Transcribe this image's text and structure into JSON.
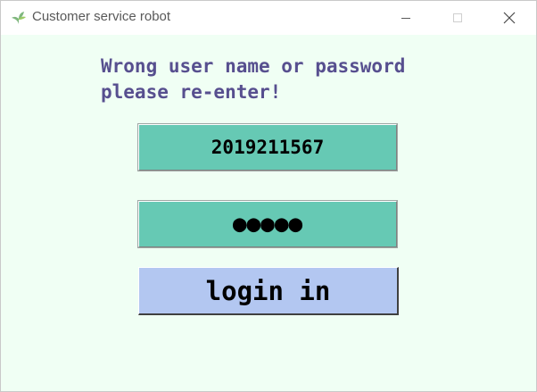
{
  "window": {
    "title": "Customer service robot",
    "icon": "leaf-icon"
  },
  "controls": {
    "minimize": "minimize-icon",
    "maximize": "maximize-icon",
    "close": "close-icon"
  },
  "form": {
    "error_line1": "Wrong user name or password",
    "error_line2": "please re-enter!",
    "username_value": "2019211567",
    "password_masked": "●●●●●",
    "login_label": "login in"
  },
  "colors": {
    "background": "#f0fff4",
    "error_text": "#574f8f",
    "input_bg": "#66c9b4",
    "button_bg": "#b3c7f1"
  }
}
